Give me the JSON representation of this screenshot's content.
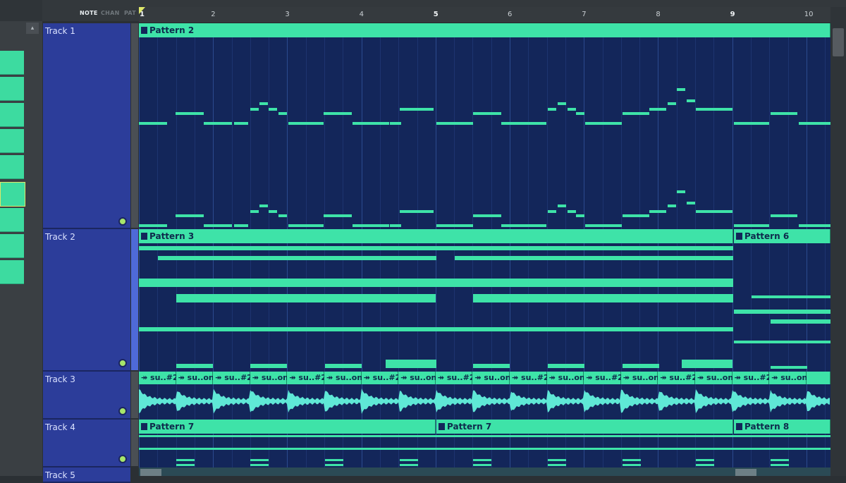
{
  "topbar": {
    "mode_tabs": [
      {
        "label": "NOTE",
        "active": true
      },
      {
        "label": "CHAN",
        "active": false
      },
      {
        "label": "PAT",
        "active": false
      }
    ]
  },
  "ruler": {
    "bars": [
      "1",
      "2",
      "3",
      "4",
      "5",
      "6",
      "7",
      "8",
      "9",
      "10"
    ]
  },
  "tracks": [
    {
      "name": "Track 1"
    },
    {
      "name": "Track 2"
    },
    {
      "name": "Track 3"
    },
    {
      "name": "Track 4"
    },
    {
      "name": "Track 5"
    }
  ],
  "clips": {
    "t1_pattern2": "Pattern 2",
    "t2_pattern3": "Pattern 3",
    "t2_pattern6": "Pattern 6",
    "t4_pattern7a": "Pattern 7",
    "t4_pattern7b": "Pattern 7",
    "t4_pattern8": "Pattern 8"
  },
  "audio_clip_labels": [
    "su..#2",
    "su..on",
    "su..#2",
    "su..on",
    "su..#2",
    "su..on",
    "su..#2",
    "su..on",
    "su..#2",
    "su..on",
    "su..#2",
    "su..on",
    "su..#2",
    "su..on",
    "su..#2",
    "su..on",
    "su..#2",
    "su..on"
  ],
  "icons": {
    "clip": "pattern-clip-icon",
    "audio": "audio-clip-icon",
    "playhead": "playhead-marker-icon",
    "mute_dot": "track-mute-led-icon"
  },
  "colors": {
    "accent": "#3ee3a8",
    "track_header": "#2c3d9a",
    "lane_bg": "#13265a"
  }
}
